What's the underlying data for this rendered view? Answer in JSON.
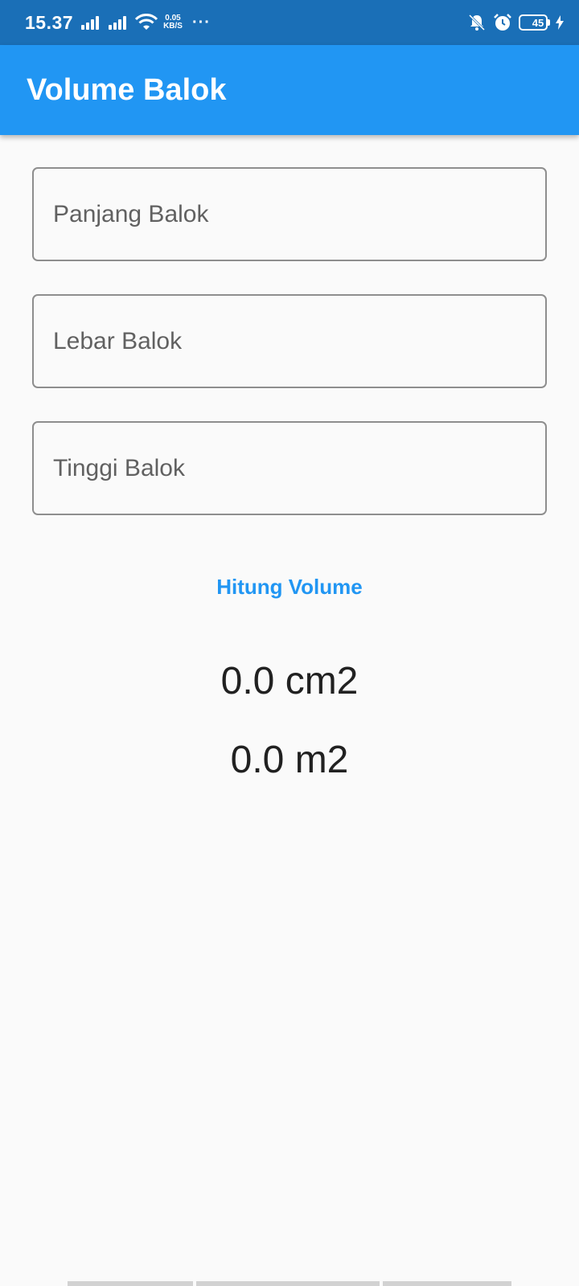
{
  "status_bar": {
    "time": "15.37",
    "speed_value": "0.05",
    "speed_unit": "KB/S",
    "more": "···",
    "battery_level": "45",
    "icons": [
      "signal-icon",
      "signal-icon",
      "wifi-icon",
      "mute-icon",
      "alarm-icon",
      "battery-icon",
      "charging-icon"
    ]
  },
  "app_bar": {
    "title": "Volume Balok",
    "color": "#2196f3"
  },
  "form": {
    "panjang_placeholder": "Panjang Balok",
    "lebar_placeholder": "Lebar Balok",
    "tinggi_placeholder": "Tinggi Balok"
  },
  "action": {
    "button_label": "Hitung Volume",
    "color": "#2196f3"
  },
  "results": {
    "cm_value": "0.0 cm2",
    "m_value": "0.0 m2"
  }
}
